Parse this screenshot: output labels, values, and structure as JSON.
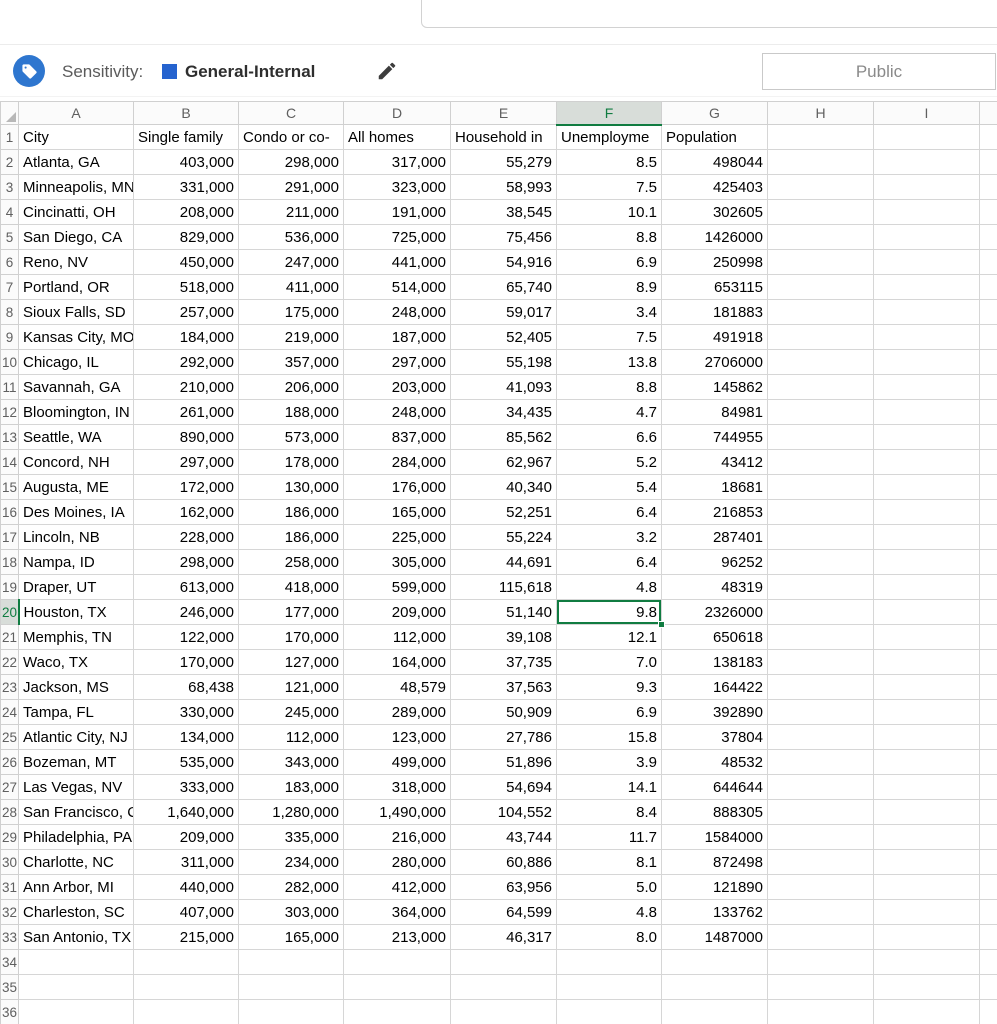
{
  "sensitivity_bar": {
    "icon": "sensitivity-label-icon",
    "label": "Sensitivity:",
    "swatch_color": "#2563cf",
    "value": "General-Internal",
    "edit_icon": "pencil-icon",
    "right_button": "Public"
  },
  "spreadsheet": {
    "column_letters": [
      "A",
      "B",
      "C",
      "D",
      "E",
      "F",
      "G",
      "H",
      "I"
    ],
    "row_count": 36,
    "selection": {
      "cell": "F20",
      "column": "F",
      "row": 20,
      "value": "9.8"
    },
    "selection_color": "#107c41",
    "rows": [
      [
        "City",
        "Single family",
        "Condo or co-",
        "All homes",
        "Household in",
        "Unemployme",
        "Population"
      ],
      [
        "Atlanta, GA",
        "403,000",
        "298,000",
        "317,000",
        "55,279",
        "8.5",
        "498044"
      ],
      [
        "Minneapolis, MN",
        "331,000",
        "291,000",
        "323,000",
        "58,993",
        "7.5",
        "425403"
      ],
      [
        "Cincinatti, OH",
        "208,000",
        "211,000",
        "191,000",
        "38,545",
        "10.1",
        "302605"
      ],
      [
        "San Diego, CA",
        "829,000",
        "536,000",
        "725,000",
        "75,456",
        "8.8",
        "1426000"
      ],
      [
        "Reno, NV",
        "450,000",
        "247,000",
        "441,000",
        "54,916",
        "6.9",
        "250998"
      ],
      [
        "Portland, OR",
        "518,000",
        "411,000",
        "514,000",
        "65,740",
        "8.9",
        "653115"
      ],
      [
        "Sioux Falls, SD",
        "257,000",
        "175,000",
        "248,000",
        "59,017",
        "3.4",
        "181883"
      ],
      [
        "Kansas City, MO",
        "184,000",
        "219,000",
        "187,000",
        "52,405",
        "7.5",
        "491918"
      ],
      [
        "Chicago, IL",
        "292,000",
        "357,000",
        "297,000",
        "55,198",
        "13.8",
        "2706000"
      ],
      [
        "Savannah, GA",
        "210,000",
        "206,000",
        "203,000",
        "41,093",
        "8.8",
        "145862"
      ],
      [
        "Bloomington, IN",
        "261,000",
        "188,000",
        "248,000",
        "34,435",
        "4.7",
        "84981"
      ],
      [
        "Seattle, WA",
        "890,000",
        "573,000",
        "837,000",
        "85,562",
        "6.6",
        "744955"
      ],
      [
        "Concord, NH",
        "297,000",
        "178,000",
        "284,000",
        "62,967",
        "5.2",
        "43412"
      ],
      [
        "Augusta, ME",
        "172,000",
        "130,000",
        "176,000",
        "40,340",
        "5.4",
        "18681"
      ],
      [
        "Des Moines, IA",
        "162,000",
        "186,000",
        "165,000",
        "52,251",
        "6.4",
        "216853"
      ],
      [
        "Lincoln, NB",
        "228,000",
        "186,000",
        "225,000",
        "55,224",
        "3.2",
        "287401"
      ],
      [
        "Nampa, ID",
        "298,000",
        "258,000",
        "305,000",
        "44,691",
        "6.4",
        "96252"
      ],
      [
        "Draper, UT",
        "613,000",
        "418,000",
        "599,000",
        "115,618",
        "4.8",
        "48319"
      ],
      [
        "Houston, TX",
        "246,000",
        "177,000",
        "209,000",
        "51,140",
        "9.8",
        "2326000"
      ],
      [
        "Memphis, TN",
        "122,000",
        "170,000",
        "112,000",
        "39,108",
        "12.1",
        "650618"
      ],
      [
        "Waco, TX",
        "170,000",
        "127,000",
        "164,000",
        "37,735",
        "7.0",
        "138183"
      ],
      [
        "Jackson, MS",
        "68,438",
        "121,000",
        "48,579",
        "37,563",
        "9.3",
        "164422"
      ],
      [
        "Tampa, FL",
        "330,000",
        "245,000",
        "289,000",
        "50,909",
        "6.9",
        "392890"
      ],
      [
        "Atlantic City, NJ",
        "134,000",
        "112,000",
        "123,000",
        "27,786",
        "15.8",
        "37804"
      ],
      [
        "Bozeman, MT",
        "535,000",
        "343,000",
        "499,000",
        "51,896",
        "3.9",
        "48532"
      ],
      [
        "Las Vegas, NV",
        "333,000",
        "183,000",
        "318,000",
        "54,694",
        "14.1",
        "644644"
      ],
      [
        "San Francisco, CA",
        "1,640,000",
        "1,280,000",
        "1,490,000",
        "104,552",
        "8.4",
        "888305"
      ],
      [
        "Philadelphia, PA",
        "209,000",
        "335,000",
        "216,000",
        "43,744",
        "11.7",
        "1584000"
      ],
      [
        "Charlotte, NC",
        "311,000",
        "234,000",
        "280,000",
        "60,886",
        "8.1",
        "872498"
      ],
      [
        "Ann Arbor, MI",
        "440,000",
        "282,000",
        "412,000",
        "63,956",
        "5.0",
        "121890"
      ],
      [
        "Charleston, SC",
        "407,000",
        "303,000",
        "364,000",
        "64,599",
        "4.8",
        "133762"
      ],
      [
        "San Antonio, TX",
        "215,000",
        "165,000",
        "213,000",
        "46,317",
        "8.0",
        "1487000"
      ],
      [],
      [],
      []
    ]
  }
}
